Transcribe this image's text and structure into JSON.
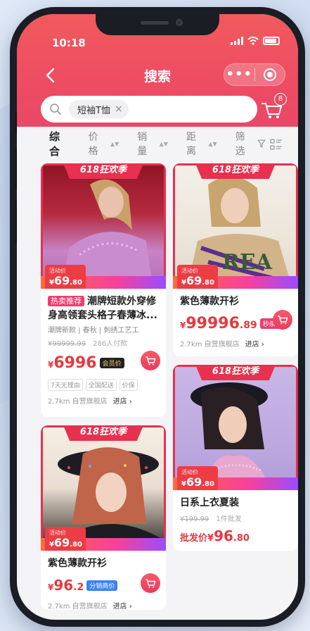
{
  "status_bar": {
    "time": "10:18"
  },
  "nav": {
    "title": "搜索",
    "more": "•••"
  },
  "search": {
    "chip": "短袖T恤",
    "chip_close": "×"
  },
  "cart": {
    "badge": "8"
  },
  "filters": [
    {
      "label": "综合"
    },
    {
      "label": "价格"
    },
    {
      "label": "销量"
    },
    {
      "label": "距离"
    },
    {
      "label": "筛选"
    }
  ],
  "event_banner": "618狂欢季",
  "promo_label": "活动价",
  "products": [
    {
      "promo_price_symbol": "¥",
      "promo_price": "69",
      "promo_price_dec": ".80",
      "hot_tag": "热卖推荐",
      "title": "潮牌短款外穿修身高领套头格子春薄冰...",
      "tags": "潮牌新款 | 春秋 | 刺绣工艺工",
      "old_price": "¥99999.99",
      "sold": "286人付款",
      "price_symbol": "¥",
      "price": "6996",
      "price_dec": "",
      "badge": "会员价",
      "services": [
        "7天无理由",
        "全国配送",
        "价保"
      ],
      "distance": "2.7km 自营旗舰店",
      "shop_link": "进店 ›"
    },
    {
      "promo_price_symbol": "¥",
      "promo_price": "69",
      "promo_price_dec": ".80",
      "title": "紫色薄款开衫",
      "price_symbol": "¥",
      "price": "99996",
      "price_dec": ".89",
      "badge": "秒杀价",
      "distance": "2.7km 自营旗舰店",
      "shop_link": "进店 ›"
    },
    {
      "promo_price_symbol": "¥",
      "promo_price": "69",
      "promo_price_dec": ".80",
      "title": "紫色薄款开衫",
      "price_symbol": "¥",
      "price": "96",
      "price_dec": ".2",
      "badge": "分销商价",
      "distance": "2.7km 自营旗舰店",
      "shop_link": "进店 ›"
    },
    {
      "promo_price_symbol": "¥",
      "promo_price": "69",
      "promo_price_dec": ".80",
      "title": "日系上衣夏装",
      "old_price": "¥199.99",
      "sold": "1件批发",
      "wholesale_label": "批发价",
      "price_symbol": "¥",
      "price": "96",
      "price_dec": ".80"
    }
  ],
  "colors": {
    "accent": "#ec3d45",
    "header": "#ef4c63"
  }
}
